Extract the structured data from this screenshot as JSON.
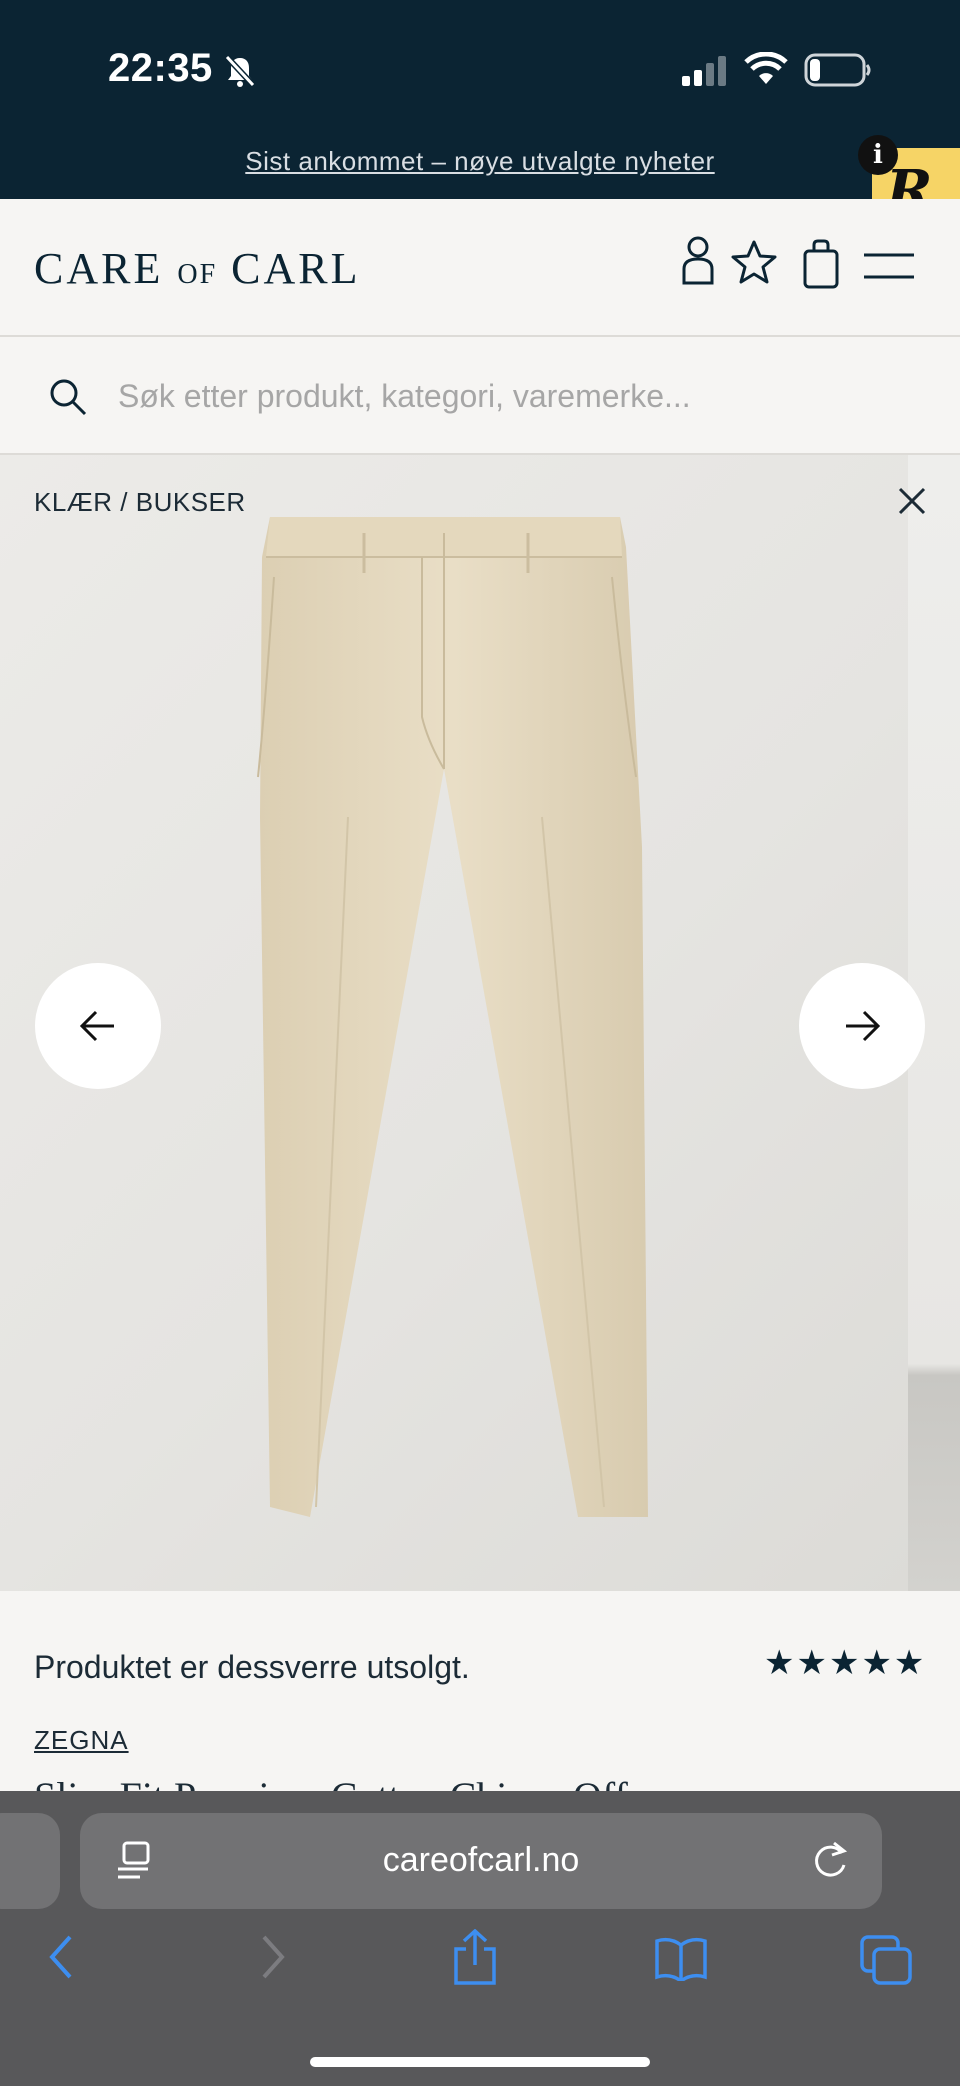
{
  "status_bar": {
    "time": "22:35"
  },
  "announcement": {
    "text": "Sist ankommet – nøye utvalgte nyheter"
  },
  "badge": {
    "letter": "R",
    "info": "i"
  },
  "header": {
    "logo_main_1": "CARE",
    "logo_of": "OF",
    "logo_main_2": "CARL"
  },
  "search": {
    "placeholder": "Søk etter produkt, kategori, varemerke..."
  },
  "gallery": {
    "breadcrumb": "KLÆR / BUKSER"
  },
  "product": {
    "status": "Produktet er dessverre utsolgt.",
    "rating_stars": "★★★★★",
    "rating": 5,
    "brand": "ZEGNA",
    "title_partial": "Slim Fit Premium Cotton Chinos Off..."
  },
  "browser": {
    "url": "careofcarl.no"
  },
  "colors": {
    "navy": "#0b2433",
    "background": "#f6f5f3",
    "badge_yellow": "#f6d466",
    "safari_blue": "#3d8ef0"
  }
}
